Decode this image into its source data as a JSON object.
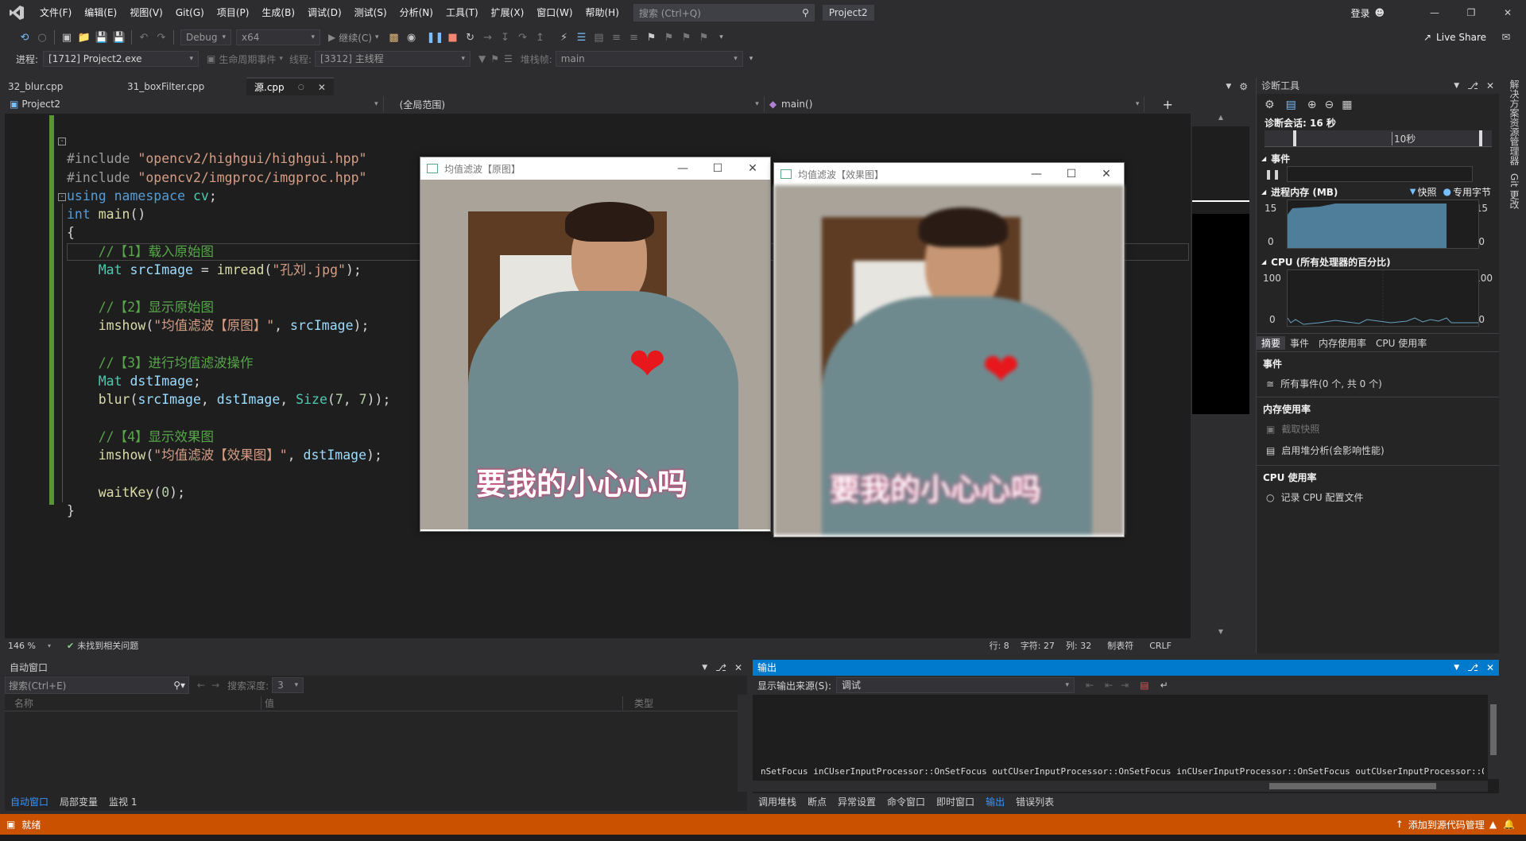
{
  "menu": [
    "文件(F)",
    "编辑(E)",
    "视图(V)",
    "Git(G)",
    "项目(P)",
    "生成(B)",
    "调试(D)",
    "测试(S)",
    "分析(N)",
    "工具(T)",
    "扩展(X)",
    "窗口(W)",
    "帮助(H)"
  ],
  "search": {
    "placeholder": "搜索 (Ctrl+Q)"
  },
  "solution_name": "Project2",
  "signin": "登录",
  "live_share": "Live Share",
  "toolbar": {
    "config": "Debug",
    "platform": "x64",
    "continue": "继续(C)"
  },
  "toolbar2": {
    "process_label": "进程:",
    "process_value": "[1712] Project2.exe",
    "lifecycle": "生命周期事件",
    "thread_label": "线程:",
    "thread_value": "[3312] 主线程",
    "stack_label": "堆栈帧:",
    "stack_value": "main"
  },
  "tabs": [
    {
      "label": "32_blur.cpp"
    },
    {
      "label": "31_boxFilter.cpp"
    },
    {
      "label": "源.cpp"
    }
  ],
  "nav": {
    "project": "Project2",
    "scope": "(全局范围)",
    "member": "main()"
  },
  "editor": {
    "zoom": "146 %",
    "issues": "未找到相关问题",
    "line": "行: 8",
    "char": "字符: 27",
    "col": "列: 32",
    "tabs": "制表符",
    "eol": "CRLF"
  },
  "code_lines": [
    "#include \"opencv2/highgui/highgui.hpp\"",
    "#include \"opencv2/imgproc/imgproc.hpp\"",
    "using namespace cv;",
    "int main()",
    "{",
    "    //【1】载入原始图",
    "    Mat srcImage = imread(\"孔刘.jpg\");",
    "",
    "    //【2】显示原始图",
    "    imshow(\"均值滤波【原图】\", srcImage);",
    "",
    "    //【3】进行均值滤波操作",
    "    Mat dstImage;",
    "    blur(srcImage, dstImage, Size(7, 7));",
    "",
    "    //【4】显示效果图",
    "    imshow(\"均值滤波【效果图】\", dstImage);",
    "",
    "    waitKey(0);",
    "}"
  ],
  "win1": {
    "title": "均值滤波【原图】",
    "caption": "要我的小心心吗"
  },
  "win2": {
    "title": "均值滤波【效果图】",
    "caption": "要我的小心心吗"
  },
  "diag": {
    "title": "诊断工具",
    "session": "诊断会话: 16 秒",
    "timeline_label": "10秒",
    "events_label": "事件",
    "mem_label": "进程内存 (MB)",
    "snapshot": "快照",
    "private_bytes": "专用字节",
    "mem_max": "15",
    "mem_min": "0",
    "cpu_label": "CPU (所有处理器的百分比)",
    "cpu_max": "100",
    "cpu_min": "0",
    "tabs": [
      "摘要",
      "事件",
      "内存使用率",
      "CPU 使用率"
    ],
    "sec_events": "事件",
    "all_events": "所有事件(0 个, 共 0 个)",
    "sec_mem": "内存使用率",
    "take_snapshot": "截取快照",
    "heap": "启用堆分析(会影响性能)",
    "sec_cpu": "CPU 使用率",
    "record_cpu": "记录 CPU 配置文件"
  },
  "side_tabs": [
    "解决方案资源管理器",
    "Git 更改"
  ],
  "autos": {
    "title": "自动窗口",
    "search_placeholder": "搜索(Ctrl+E)",
    "depth_label": "搜索深度:",
    "depth": "3",
    "col_name": "名称",
    "col_value": "值",
    "col_type": "类型",
    "tabs": [
      "自动窗口",
      "局部变量",
      "监视 1"
    ]
  },
  "output": {
    "title": "输出",
    "source_label": "显示输出来源(S):",
    "source": "调试",
    "text": "nSetFocus inCUserInputProcessor::OnSetFocus outCUserInputProcessor::OnSetFocus inCUserInputProcessor::OnSetFocus outCUserInputProcessor::OnSetFocus out",
    "tabs": [
      "调用堆栈",
      "断点",
      "异常设置",
      "命令窗口",
      "即时窗口",
      "输出",
      "错误列表"
    ]
  },
  "status": {
    "ready": "就绪",
    "source_control": "添加到源代码管理"
  },
  "colors": {
    "accent": "#007acc",
    "status_bg": "#ca5100",
    "editor_bg": "#1e1e1e"
  }
}
